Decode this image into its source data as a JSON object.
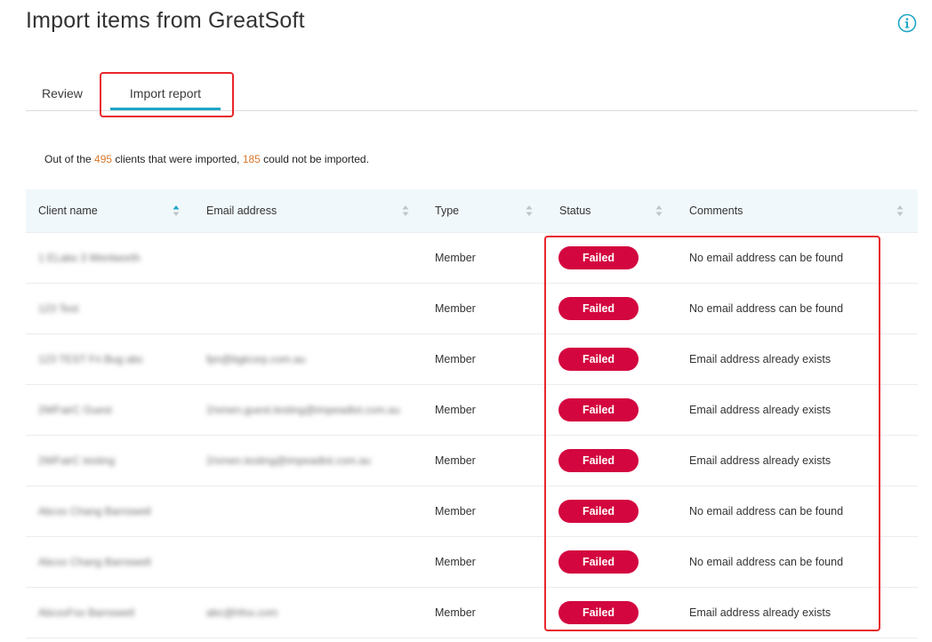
{
  "header": {
    "title": "Import items from GreatSoft",
    "info_icon": "info-icon"
  },
  "tabs": [
    {
      "label": "Review",
      "active": false
    },
    {
      "label": "Import report",
      "active": true
    }
  ],
  "summary": {
    "prefix": "Out of the ",
    "total": "495",
    "middle": " clients that were imported, ",
    "failed": "185",
    "suffix": " could not be imported."
  },
  "table": {
    "columns": [
      "Client name",
      "Email address",
      "Type",
      "Status",
      "Comments"
    ],
    "rows": [
      {
        "name": "1 ELabs 3 Wentworth",
        "email": "",
        "type": "Member",
        "status": "Failed",
        "comment": "No email address can be found"
      },
      {
        "name": "123 Test",
        "email": "",
        "type": "Member",
        "status": "Failed",
        "comment": "No email address can be found"
      },
      {
        "name": "123 TEST Fri Bug abc",
        "email": "fpn@bgtcorp.com.au",
        "type": "Member",
        "status": "Failed",
        "comment": "Email address already exists"
      },
      {
        "name": "2WFairC Guest",
        "email": "2/xmen.guest.testing@impeadlot.com.au",
        "type": "Member",
        "status": "Failed",
        "comment": "Email address already exists"
      },
      {
        "name": "2WFairC testing",
        "email": "2/xmen.testing@impeadlot.com.au",
        "type": "Member",
        "status": "Failed",
        "comment": "Email address already exists"
      },
      {
        "name": "Abcxx Chang Barnswell",
        "email": "",
        "type": "Member",
        "status": "Failed",
        "comment": "No email address can be found"
      },
      {
        "name": "Abcxx Chang Barnswell",
        "email": "",
        "type": "Member",
        "status": "Failed",
        "comment": "No email address can be found"
      },
      {
        "name": "AbcxxFox Barnswell",
        "email": "abc@hfox.com",
        "type": "Member",
        "status": "Failed",
        "comment": "Email address already exists"
      }
    ]
  },
  "colors": {
    "accent": "#1ea5c8",
    "failed_badge": "#d3063f",
    "highlight": "#e8262c",
    "count": "#d9772b"
  }
}
